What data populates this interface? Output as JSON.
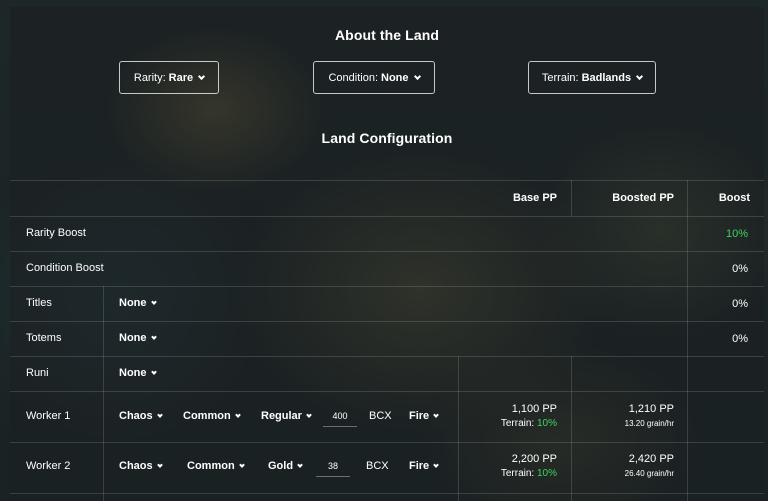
{
  "about": {
    "title": "About the Land",
    "rarity": {
      "label": "Rarity:",
      "value": "Rare"
    },
    "condition": {
      "label": "Condition:",
      "value": "None"
    },
    "terrain": {
      "label": "Terrain:",
      "value": "Badlands"
    }
  },
  "config": {
    "title": "Land Configuration",
    "headers": {
      "base": "Base PP",
      "boosted": "Boosted PP",
      "boost": "Boost"
    },
    "rows": {
      "rarity": {
        "label": "Rarity Boost",
        "boost": "10%"
      },
      "condition": {
        "label": "Condition Boost",
        "boost": "0%"
      },
      "titles": {
        "label": "Titles",
        "select": "None",
        "boost": "0%"
      },
      "totems": {
        "label": "Totems",
        "select": "None",
        "boost": "0%"
      },
      "runi": {
        "label": "Runi",
        "select": "None"
      }
    },
    "workers": [
      {
        "label": "Worker 1",
        "element": "Chaos",
        "rarity": "Common",
        "foil": "Regular",
        "bcx": "400",
        "bcx_unit": "BCX",
        "type": "Fire",
        "base_pp": "1,100 PP",
        "terrain_label": "Terrain:",
        "terrain_pct": "10%",
        "boosted_pp": "1,210 PP",
        "grain": "13.20 grain/hr"
      },
      {
        "label": "Worker 2",
        "element": "Chaos",
        "rarity": "Common",
        "foil": "Gold",
        "bcx": "38",
        "bcx_unit": "BCX",
        "type": "Fire",
        "base_pp": "2,200 PP",
        "terrain_label": "Terrain:",
        "terrain_pct": "10%",
        "boosted_pp": "2,420 PP",
        "grain": "26.40 grain/hr"
      }
    ]
  },
  "colors": {
    "accent_green": "#3dd35f",
    "panel": "#1c2022",
    "text": "#ffffff"
  }
}
